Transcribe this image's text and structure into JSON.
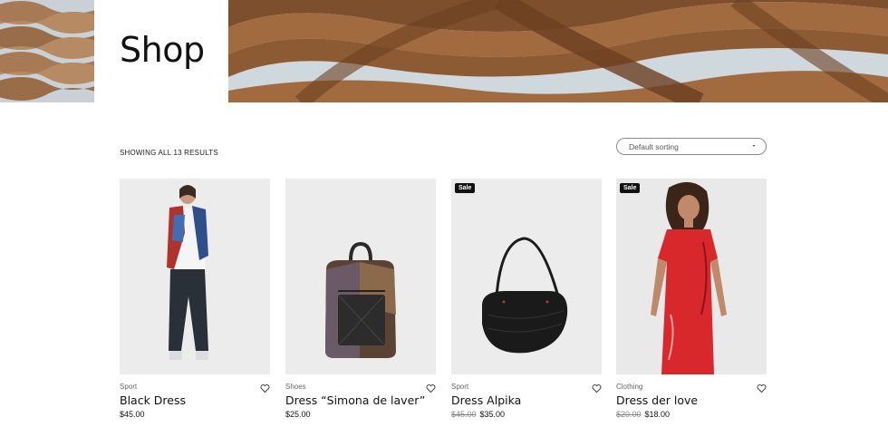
{
  "header": {
    "title": "Shop"
  },
  "toolbar": {
    "results_text": "SHOWING ALL 13 RESULTS",
    "sort": {
      "selected": "Default sorting"
    }
  },
  "products": [
    {
      "category": "Sport",
      "name": "Black Dress",
      "price": "$45.00",
      "old_price": "",
      "badge": ""
    },
    {
      "category": "Shoes",
      "name": "Dress “Simona de laver”",
      "price": "$25.00",
      "old_price": "",
      "badge": ""
    },
    {
      "category": "Sport",
      "name": "Dress Alpika",
      "price": "$35.00",
      "old_price": "$45.00",
      "badge": "Sale"
    },
    {
      "category": "Clothing",
      "name": "Dress der love",
      "price": "$18.00",
      "old_price": "$20.00",
      "badge": "Sale"
    }
  ],
  "icons": {
    "wishlist": "heart-icon",
    "sort_caret": "caret-down-icon"
  },
  "colors": {
    "badge_bg": "#111111",
    "page_bg": "#ffffff",
    "wood": "#8a5a36"
  }
}
